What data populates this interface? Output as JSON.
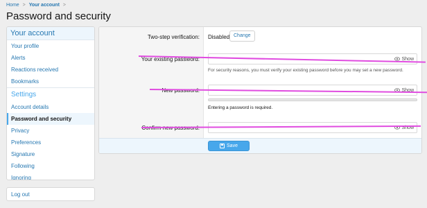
{
  "breadcrumb": {
    "home": "Home",
    "separator": ">",
    "account": "Your account"
  },
  "page_title": "Password and security",
  "sidebar": {
    "header": "Your account",
    "items_top": [
      {
        "label": "Your profile"
      },
      {
        "label": "Alerts"
      },
      {
        "label": "Reactions received"
      },
      {
        "label": "Bookmarks"
      }
    ],
    "section": "Settings",
    "items_settings": [
      {
        "label": "Account details"
      },
      {
        "label": "Password and security",
        "active": true
      },
      {
        "label": "Privacy"
      },
      {
        "label": "Preferences"
      },
      {
        "label": "Signature"
      },
      {
        "label": "Following"
      },
      {
        "label": "Ignoring"
      }
    ],
    "logout": "Log out"
  },
  "form": {
    "two_step_label": "Two-step verification:",
    "two_step_status": "Disabled",
    "change_button": "Change",
    "existing_label": "Your existing password:",
    "existing_hint": "For security reasons, you must verify your existing password before you may set a new password.",
    "new_label": "New password:",
    "new_hint": "Entering a password is required.",
    "confirm_label": "Confirm new password:",
    "show_label": "Show",
    "save_button": "Save"
  },
  "colors": {
    "accent": "#47a7eb",
    "link": "#2577b1",
    "annotation": "#e04ce0"
  },
  "icons": {
    "eye": "eye-icon",
    "save": "save-icon"
  }
}
